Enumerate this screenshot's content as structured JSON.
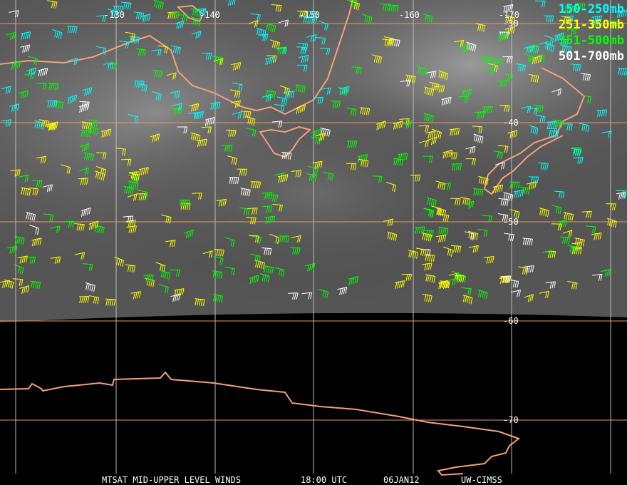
{
  "title": "MTSAT MID-UPPER LEVEL WINDS",
  "time": "18:00 UTC",
  "date": "06JAN12",
  "source": "UW-CIMSS",
  "longitude_labels": [
    "-130",
    "-140",
    "-150",
    "-160",
    "-170"
  ],
  "latitude_labels": [
    "-30",
    "-40",
    "-50",
    "-60",
    "-70"
  ],
  "legend": [
    {
      "label": "150-250mb",
      "color": "#00ffff"
    },
    {
      "label": "251-350mb",
      "color": "#ffff00"
    },
    {
      "label": "351-500mb",
      "color": "#00ff00"
    },
    {
      "label": "501-700mb",
      "color": "#ffffff"
    }
  ],
  "colors": {
    "coastline": "#f4a07a",
    "lat_grid": "#e8966a",
    "lon_grid": "#bbbbbb",
    "imagery": "#5a5a5a",
    "space": "#000000"
  }
}
